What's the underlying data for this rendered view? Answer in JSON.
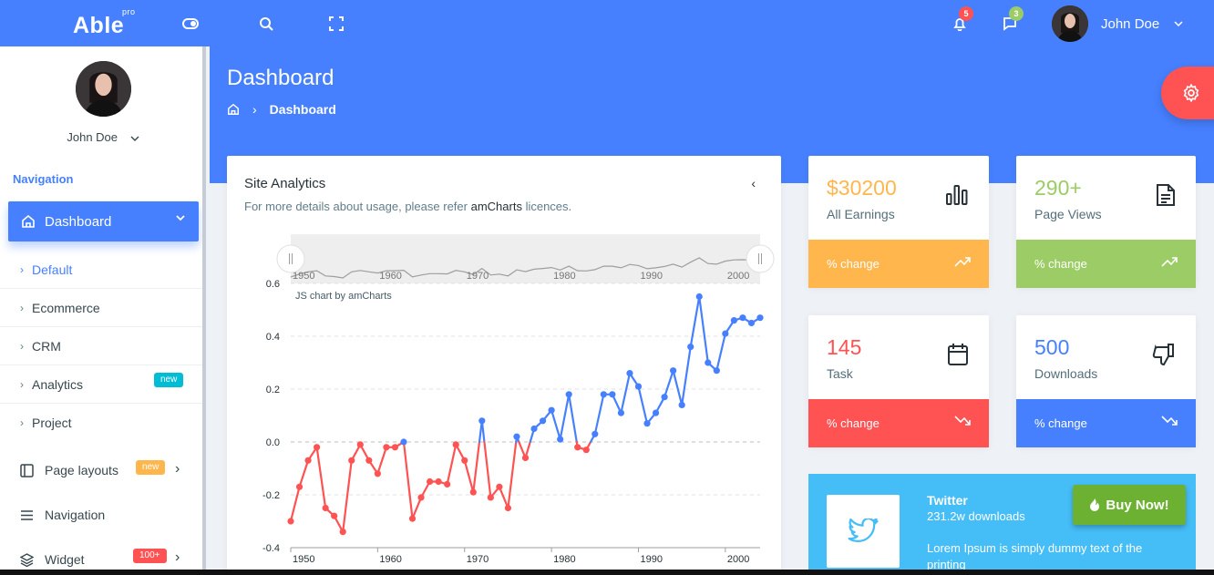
{
  "topbar": {
    "logo": "Able",
    "logo_sup": "pro",
    "notif_count": "5",
    "msg_count": "3",
    "user_name": "John Doe"
  },
  "sidebar": {
    "user_name": "John Doe",
    "caption": "Navigation",
    "active": "Dashboard",
    "sub_items": [
      "Default",
      "Ecommerce",
      "CRM",
      "Analytics",
      "Project"
    ],
    "analytics_badge": "new",
    "items": [
      {
        "label": "Page layouts",
        "badge": "new"
      },
      {
        "label": "Navigation"
      },
      {
        "label": "Widget",
        "badge": "100+"
      }
    ]
  },
  "header": {
    "title": "Dashboard",
    "breadcrumb": "Dashboard"
  },
  "analytics": {
    "title": "Site Analytics",
    "subtitle_pre": "For more details about usage, please refer ",
    "subtitle_link": "amCharts",
    "subtitle_post": " licences."
  },
  "stats": [
    {
      "value": "$30200",
      "label": "All Earnings",
      "foot": "% change",
      "color": "#ffb64d",
      "icon": "bar-chart-icon",
      "trend": "up"
    },
    {
      "value": "290+",
      "label": "Page Views",
      "foot": "% change",
      "color": "#9ccc65",
      "icon": "file-text-icon",
      "trend": "up"
    },
    {
      "value": "145",
      "label": "Task",
      "foot": "% change",
      "color": "#ff5252",
      "icon": "calendar-icon",
      "trend": "down"
    },
    {
      "value": "500",
      "label": "Downloads",
      "foot": "% change",
      "color": "#4680ff",
      "icon": "thumbs-down-icon",
      "trend": "down"
    }
  ],
  "twitter": {
    "title": "Twitter",
    "subtitle": "231.2w downloads",
    "desc": "Lorem Ipsum is simply dummy text of the printing",
    "buy_label": "Buy Now!"
  },
  "colors": {
    "primary": "#4680ff",
    "danger": "#ff5252",
    "warning": "#ffb64d",
    "success": "#9ccc65",
    "twitter": "#45bdf6",
    "positive_series": "#4680ff",
    "negative_series": "#ff5252"
  },
  "chart_data": {
    "type": "line",
    "credit": "JS chart by amCharts",
    "x_ticks": [
      "1950",
      "1960",
      "1970",
      "1980",
      "1990",
      "2000"
    ],
    "y_ticks": [
      "0.6",
      "0.4",
      "0.2",
      "0.0",
      "-0.2",
      "-0.4"
    ],
    "xlim": [
      1950,
      2004
    ],
    "ylim": [
      -0.4,
      0.6
    ],
    "grid": true,
    "scrollbar": true,
    "x": [
      1950,
      1951,
      1952,
      1953,
      1954,
      1955,
      1956,
      1957,
      1958,
      1959,
      1960,
      1961,
      1962,
      1963,
      1964,
      1965,
      1966,
      1967,
      1968,
      1969,
      1970,
      1971,
      1972,
      1973,
      1974,
      1975,
      1976,
      1977,
      1978,
      1979,
      1980,
      1981,
      1982,
      1983,
      1984,
      1985,
      1986,
      1987,
      1988,
      1989,
      1990,
      1991,
      1992,
      1993,
      1994,
      1995,
      1996,
      1997,
      1998,
      1999,
      2000,
      2001,
      2002,
      2003,
      2004
    ],
    "y": [
      -0.3,
      -0.17,
      -0.07,
      -0.02,
      -0.25,
      -0.28,
      -0.34,
      -0.07,
      -0.01,
      -0.07,
      -0.12,
      -0.02,
      -0.02,
      0.0,
      -0.29,
      -0.21,
      -0.15,
      -0.15,
      -0.16,
      -0.01,
      -0.07,
      -0.19,
      0.08,
      -0.21,
      -0.17,
      -0.25,
      0.02,
      -0.06,
      0.05,
      0.08,
      0.12,
      0.01,
      0.18,
      -0.02,
      -0.03,
      0.03,
      0.18,
      0.18,
      0.11,
      0.26,
      0.21,
      0.07,
      0.11,
      0.17,
      0.27,
      0.14,
      0.36,
      0.55,
      0.3,
      0.27,
      0.41,
      0.46,
      0.47,
      0.45,
      0.47
    ]
  }
}
